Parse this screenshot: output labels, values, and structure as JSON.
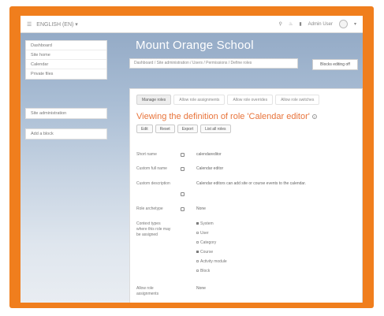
{
  "navbar": {
    "menu_icon": "hamburger-icon",
    "language": "ENGLISH (EN) ▾",
    "search_icon": "search-icon",
    "notifications_icon": "bell-icon",
    "messages_icon": "chat-icon",
    "user_name": "Admin User",
    "user_menu_caret": "▾"
  },
  "nav_block": {
    "items": [
      "Dashboard",
      "Site home",
      "Calendar",
      "Private files"
    ]
  },
  "admin_block": {
    "label": "Site administration"
  },
  "add_block": {
    "label": "Add a block"
  },
  "header": {
    "site_title": "Mount Orange School",
    "breadcrumb": "Dashboard / Site administration / Users / Permissions / Define roles",
    "blocks_button": "Blocks editing off"
  },
  "tabs": [
    "Manage roles",
    "Allow role assignments",
    "Allow role overrides",
    "Allow role switches"
  ],
  "page": {
    "title": "Viewing the definition of role 'Calendar editor'",
    "help_icon": "help-icon",
    "buttons": [
      "Edit",
      "Reset",
      "Export",
      "List all roles"
    ]
  },
  "fields": {
    "short_name": {
      "label": "Short name",
      "value": "calendareditor"
    },
    "full_name": {
      "label": "Custom full name",
      "value": "Calendar editor"
    },
    "description": {
      "label": "Custom description",
      "value": "Calendar editors can add site or course events to the calendar."
    },
    "archetype": {
      "label": "Role archetype",
      "value": "None"
    },
    "context": {
      "label": "Context types where this role may be assigned",
      "options": [
        {
          "label": "System",
          "checked": true
        },
        {
          "label": "User",
          "checked": false
        },
        {
          "label": "Category",
          "checked": false
        },
        {
          "label": "Course",
          "checked": true
        },
        {
          "label": "Activity module",
          "checked": false
        },
        {
          "label": "Block",
          "checked": false
        }
      ]
    },
    "allow_assign": {
      "label": "Allow role assignments",
      "value": "None"
    }
  },
  "colors": {
    "frame_orange": "#f07e1d",
    "title_orange": "#e8743b"
  }
}
